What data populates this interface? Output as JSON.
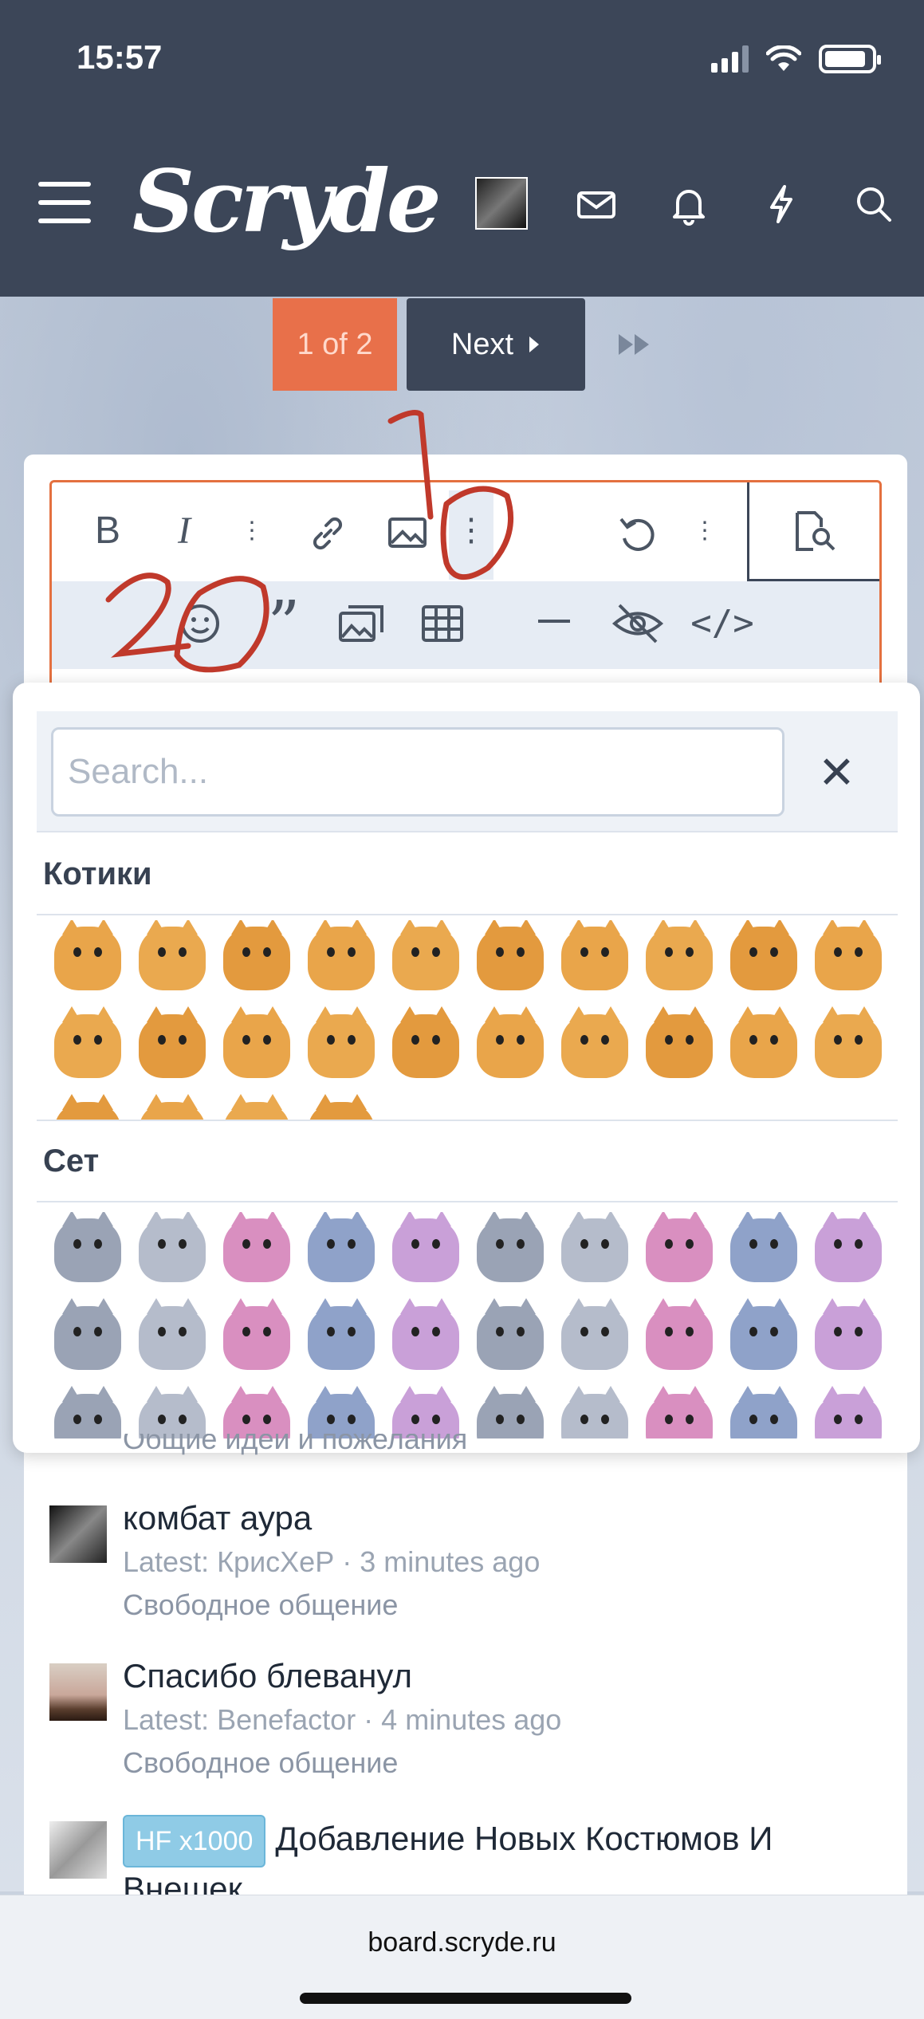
{
  "status": {
    "time": "15:57",
    "battery_level": 0.9
  },
  "header": {
    "logo": "Scryde"
  },
  "pagination": {
    "current": "1 of 2",
    "next": "Next"
  },
  "emoji_picker": {
    "search_placeholder": "Search...",
    "sections": [
      {
        "title": "Котики"
      },
      {
        "title": "Сет"
      }
    ]
  },
  "threads": [
    {
      "title": "Общие идеи и пожелания"
    },
    {
      "title": "комбат аура",
      "latest": "Latest: КрисХеР · 3 minutes ago",
      "forum": "Свободное общение"
    },
    {
      "title": "Спасибо блеванул",
      "latest": "Latest: Benefactor · 4 minutes ago",
      "forum": "Свободное общение"
    },
    {
      "prefix": "HF x1000",
      "title": "Добавление Новых Костюмов И Внешек"
    }
  ],
  "browser": {
    "url": "board.scryde.ru"
  },
  "annotations": {
    "mark_1": "1",
    "mark_2": "2"
  },
  "colors": {
    "header": "#3c4658",
    "accent": "#e8704a",
    "annotation": "#c0392b"
  }
}
